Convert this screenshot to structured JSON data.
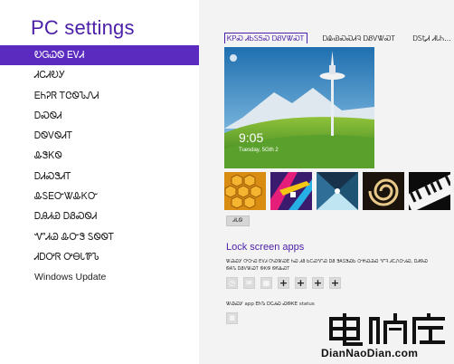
{
  "nav": {
    "title": "PC settings",
    "items": [
      {
        "label": "ᎧᏀᏇᏫ ᎬᏙᏗ",
        "selected": true
      },
      {
        "label": "ᏗᏟᏗᎧᎩ",
        "selected": false
      },
      {
        "label": "ᎬᏂᎮᏒ ᎢᏣᏫᏖᏁᏗ",
        "selected": false
      },
      {
        "label": "ᎠᏍᏫᏗ",
        "selected": false
      },
      {
        "label": "ᎠᏫᏙᏫᏗᎢ",
        "selected": false
      },
      {
        "label": "ᎲᏕᏦᏫ",
        "selected": false
      },
      {
        "label": "ᎠᏗᏍᏕᏗᎢ",
        "selected": false
      },
      {
        "label": "ᎲᏚᎬᏅᏔᎲᏦᏅ",
        "selected": false
      },
      {
        "label": "ᎠᎯᏗᏯ ᎠᏰᏍᏫᏗ",
        "selected": false
      },
      {
        "label": "ᏉᏗᏊ ᎲᏅᏕ ᏚᏫᏫᎢ",
        "selected": false
      },
      {
        "label": "ᏗᎠᎤᏒ ᎤᎾᏓᏈᏖ",
        "selected": false
      },
      {
        "label": "Windows Update",
        "selected": false
      }
    ]
  },
  "tabs": [
    {
      "label": "ᏦᏢᏍ ᏗᏏᏚᎦᏍ ᎠᏰᏙᏔᏍᎢ",
      "active": true
    },
    {
      "label": "ᎠᎲᏯᏍᏍᏗᎸ ᎠᏰᏙᏔᏍᎢ",
      "active": false
    },
    {
      "label": "ᎠᏚᎿᏗ ᏗᏓᏂ...",
      "active": false
    }
  ],
  "preview": {
    "time": "9:05",
    "date": "Tuesday, 5Gth 2"
  },
  "thumbnails": [
    {
      "name": "honeycomb-thumbnail"
    },
    {
      "name": "abstract-colors-thumbnail"
    },
    {
      "name": "tunnel-thumbnail"
    },
    {
      "name": "nautilus-thumbnail"
    },
    {
      "name": "piano-thumbnail"
    }
  ],
  "browse_button": "ᏗᏓᏫ",
  "lock_apps": {
    "title": "Lock screen apps",
    "description": "ᏔᏊᏍᎩ ᎤᏅᏍ ᎬᏙᏗ ᎤᏍᏔᏍᎬ ᏂᏍ ᏗᏰ ᏏᏟᏍᏉᏍ ᎠᏰ ᏕᎪᏚᏕᏍᏏ ᏅᏥᏍᏊᏍ ᏉᎸ ᏗᏟᏁᏅᏗᏍ, ᎠᏗᏫᏍ ᏫᎪᏖ ᎠᏰᏙᏔᏍᎢ ᏫᏦᏫ ᏫᏲᎲᏍᎢ",
    "slot_icons": [
      "clock-icon",
      "mail-icon",
      "calendar-icon",
      "plus-icon",
      "plus-icon",
      "plus-icon",
      "plus-icon"
    ],
    "detail_label": "ᏔᏊᏍᎩ app ᎬᏂᏖ ᎠᏟᏗᏍ ᏍᏫᏦᎬ status",
    "detail_icon": "calendar-icon"
  },
  "watermark": {
    "text": "DianNaoDian.com"
  }
}
